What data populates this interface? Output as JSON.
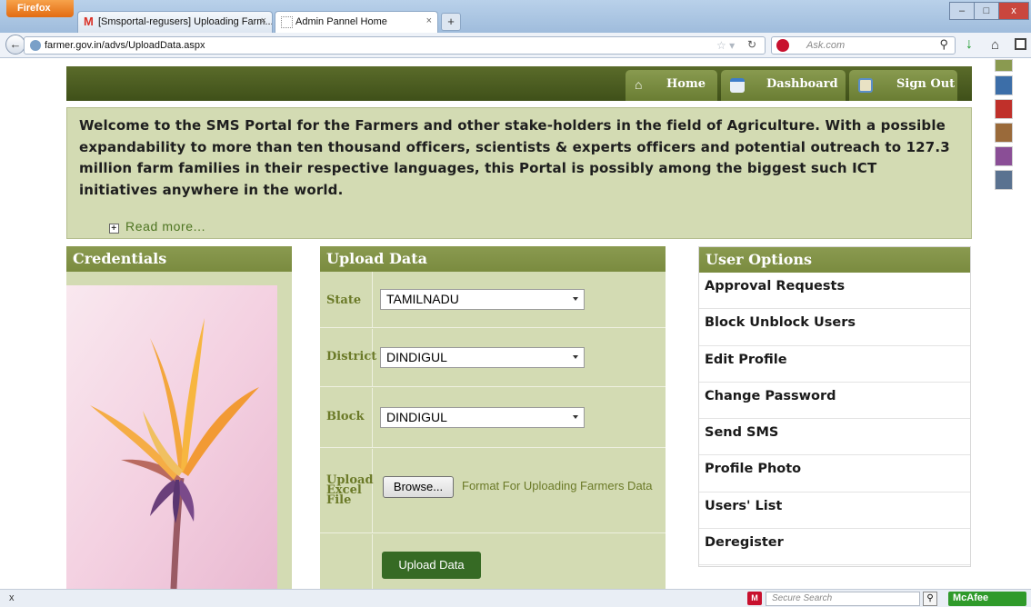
{
  "browser": {
    "app_button": "Firefox",
    "tabs": [
      {
        "label": "[Smsportal-regusers] Uploading Farm...",
        "close": "×"
      },
      {
        "label": "Admin Pannel Home",
        "close": "×"
      }
    ],
    "new_tab": "+",
    "url": "farmer.gov.in/advs/UploadData.aspx",
    "search_placeholder": "Ask.com",
    "window_controls": {
      "minimize": "–",
      "maximize": "□",
      "close": "x"
    }
  },
  "topnav": {
    "home": "Home",
    "dashboard": "Dashboard",
    "signout": "Sign Out"
  },
  "welcome": {
    "text": "Welcome to the SMS Portal for the Farmers and other stake-holders in the field of Agriculture. With a possible expandability to more than ten thousand officers, scientists & experts officers and potential outreach to 127.3 million farm families in their respective languages, this Portal is possibly among the biggest such ICT initiatives anywhere in the world.",
    "read_more": "Read more..."
  },
  "credentials": {
    "title": "Credentials"
  },
  "upload_data": {
    "title": "Upload Data",
    "state_label": "State",
    "state_value": "TAMILNADU",
    "district_label": "District",
    "district_value": "DINDIGUL",
    "block_label": "Block",
    "block_value": "DINDIGUL",
    "file_label": "Upload Excel File",
    "browse_button": "Browse...",
    "format_link": "Format For Uploading Farmers Data",
    "submit_button": "Upload Data"
  },
  "user_options": {
    "title": "User Options",
    "items": [
      "Approval Requests",
      "Block Unblock Users",
      "Edit Profile",
      "Change Password",
      "Send SMS",
      "Profile Photo",
      "Users' List",
      "Deregister"
    ]
  },
  "theme_swatches": [
    "#8a9a50",
    "#3c6ea8",
    "#c0302a",
    "#9a6a3a",
    "#8a4e96",
    "#5a7290"
  ],
  "statusbar": {
    "close_glyph": "x",
    "secure_search_placeholder": "Secure Search",
    "mcafee": "McAfee"
  }
}
